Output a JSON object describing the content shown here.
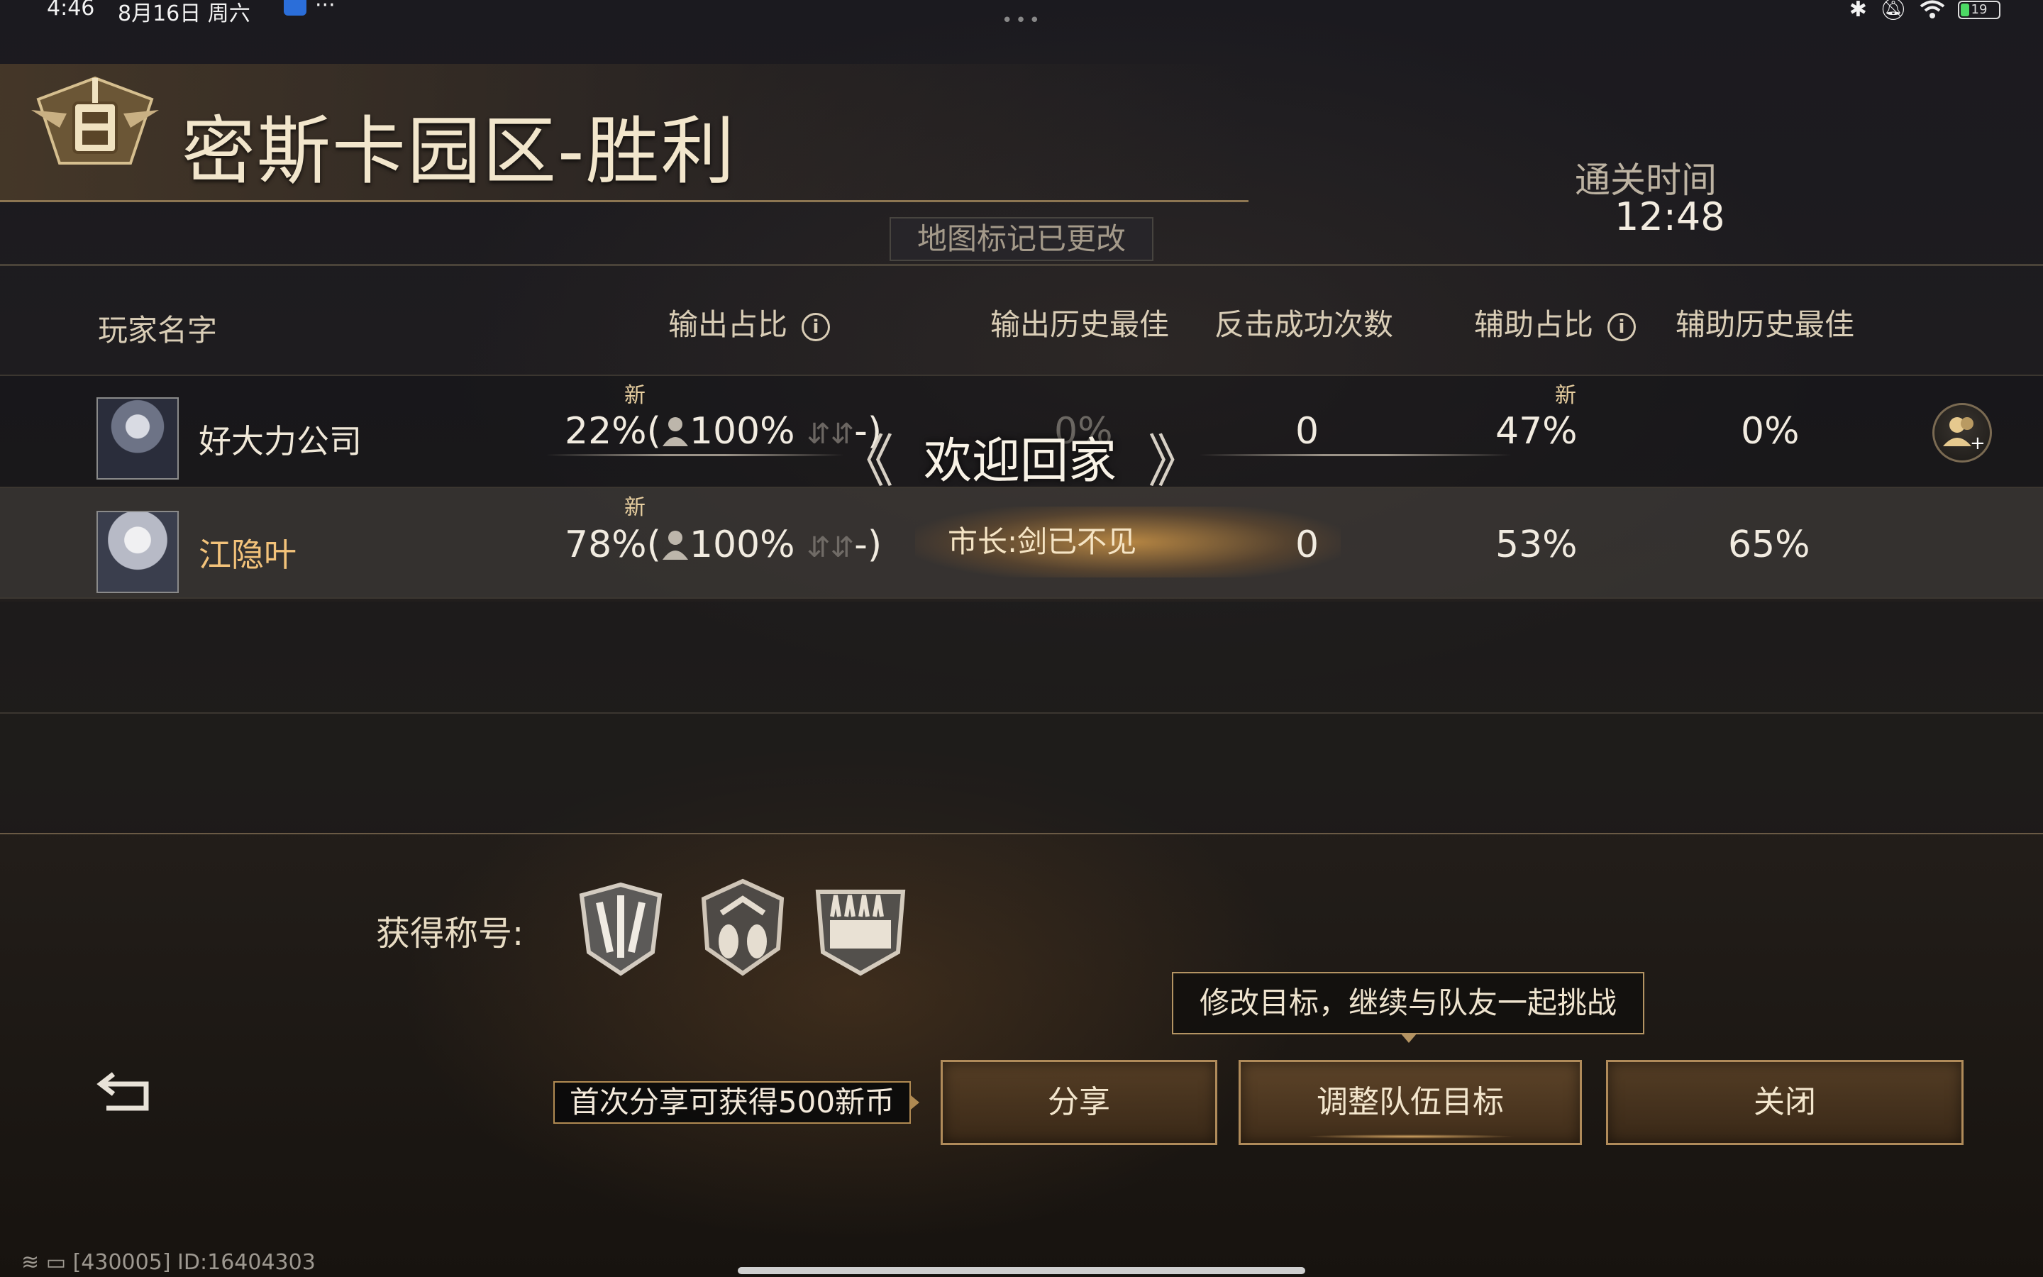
{
  "status_bar": {
    "time": "4:46",
    "date": "8月16日 周六",
    "more": "···",
    "battery": "19"
  },
  "header": {
    "title": "密斯卡园区-胜利",
    "clear_time_label": "通关时间",
    "clear_time_value": "12:48",
    "map_notice": "地图标记已更改"
  },
  "table": {
    "headers": {
      "player_name": "玩家名字",
      "damage_share": "输出占比",
      "damage_best": "输出历史最佳",
      "counter_count": "反击成功次数",
      "support_share": "辅助占比",
      "support_best": "辅助历史最佳"
    },
    "new_label": "新",
    "rows": [
      {
        "name": "好大力公司",
        "damage_share": "22%(",
        "damage_team": "100%",
        "damage_tail": "-)",
        "damage_best": "0%",
        "counter": "0",
        "support_share": "47%",
        "support_best": "0%"
      },
      {
        "name": "江隐叶",
        "damage_share": "78%(",
        "damage_team": "100%",
        "damage_tail": "-)",
        "damage_best": "市长:剑已不见",
        "counter": "0",
        "support_share": "53%",
        "support_best": "65%"
      }
    ]
  },
  "welcome": {
    "text": "欢迎回家",
    "left_chevron": "《",
    "right_chevron": "》"
  },
  "bottom": {
    "titles_label": "获得称号:",
    "tooltip": "修改目标，继续与队友一起挑战",
    "share_hint": "首次分享可获得500新币",
    "share_button": "分享",
    "adjust_button": "调整队伍目标",
    "close_button": "关闭",
    "footer_info": "[430005] ID:16404303"
  },
  "colors": {
    "accent_gold": "#b08b5a",
    "name_highlight": "#f2c27a"
  }
}
